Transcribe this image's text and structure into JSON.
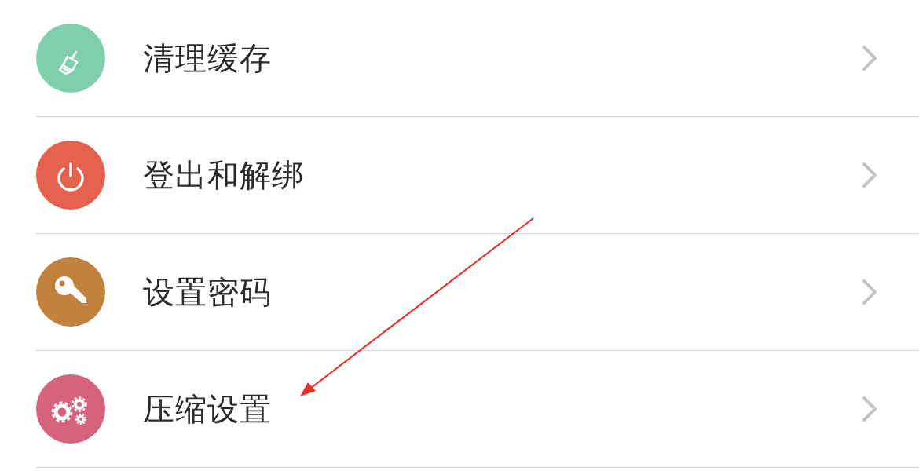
{
  "settings_items": [
    {
      "label": "清理缓存",
      "kind": "broom",
      "color": "#7fcfac"
    },
    {
      "label": "登出和解绑",
      "kind": "power",
      "color": "#e4614b"
    },
    {
      "label": "设置密码",
      "kind": "key",
      "color": "#c1823f"
    },
    {
      "label": "压缩设置",
      "kind": "gears",
      "color": "#d6637b"
    }
  ],
  "annotations": [
    {
      "kind": "arrow"
    }
  ]
}
